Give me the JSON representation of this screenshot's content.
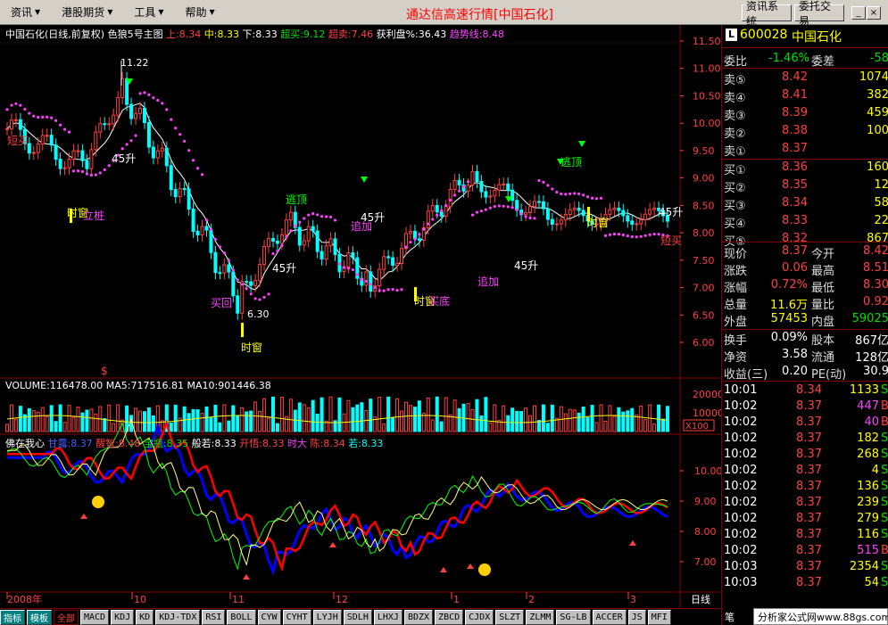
{
  "menubar": {
    "items": [
      {
        "label": "资讯"
      },
      {
        "label": "港股期货"
      },
      {
        "label": "工具"
      },
      {
        "label": "帮助"
      }
    ],
    "title": "通达信高速行情[中国石化]",
    "btn_info": "资讯系统",
    "btn_trade": "委托交易"
  },
  "price_header": {
    "name": "中国石化(日线,前复权)",
    "style": "色狼5号主图",
    "up": "上:8.34",
    "mid": "中:8.33",
    "down": "下:8.33",
    "overbuy": "超买:9.12",
    "oversell": "超卖:7.46",
    "profit": "获利盘%:36.43",
    "trend": "趋势线:8.48"
  },
  "price_axis": [
    "11.50",
    "11.00",
    "10.50",
    "10.00",
    "9.50",
    "9.00",
    "8.50",
    "8.00",
    "7.50",
    "7.00",
    "6.50",
    "6.00"
  ],
  "annotations": {
    "high": "11.22",
    "low": "6.30",
    "short_buy": "短买",
    "time_window": "时窗",
    "rise45": "45升",
    "escape_top": "逃顶",
    "chase": "追加",
    "buy_bottom": "买底",
    "buy_back": "买回",
    "support": "立桩"
  },
  "volume_header": {
    "volume": "VOLUME:116478.00",
    "ma5": "MA5:717516.81",
    "ma10": "MA10:901446.38"
  },
  "volume_axis": [
    "20000",
    "10000"
  ],
  "volume_unit": "X100",
  "indicator_header": {
    "name": "佛在我心",
    "sweet": "甘露:8.37",
    "wake": "醒智:8.48",
    "treasure": "宝瓶:8.35",
    "prajna": "般若:8.33",
    "open": "开悟:8.33",
    "gold": "时大",
    "chen": "陈:8.34",
    "ruo": "若:8.33"
  },
  "indicator_axis": [
    "10.00",
    "9.00",
    "8.00",
    "7.00"
  ],
  "time_axis": [
    "2008年",
    "10",
    "11",
    "12",
    "1",
    "2",
    "3"
  ],
  "period_label": "日线",
  "tabs": [
    "指标",
    "模板",
    "全部",
    "MACD",
    "KDJ",
    "KD",
    "KDJ-TDX",
    "RSI",
    "BOLL",
    "CYW",
    "CYHT",
    "LYJH",
    "SDLH",
    "LHXJ",
    "BDZX",
    "ZBCD",
    "CJDX",
    "SLZT",
    "ZLMM",
    "SG-LB",
    "ACCER",
    "JS",
    "MFI"
  ],
  "quote": {
    "code": "600028",
    "name": "中国石化",
    "weibi_label": "委比",
    "weibi": "-1.46%",
    "weicha_label": "委差",
    "weicha": "-58",
    "asks": [
      {
        "label": "卖⑤",
        "price": "8.42",
        "vol": "1074"
      },
      {
        "label": "卖④",
        "price": "8.41",
        "vol": "382"
      },
      {
        "label": "卖③",
        "price": "8.39",
        "vol": "459"
      },
      {
        "label": "卖②",
        "price": "8.38",
        "vol": "100"
      },
      {
        "label": "卖①",
        "price": "8.37",
        "vol": ""
      }
    ],
    "bids": [
      {
        "label": "买①",
        "price": "8.36",
        "vol": "160"
      },
      {
        "label": "买②",
        "price": "8.35",
        "vol": "12"
      },
      {
        "label": "买③",
        "price": "8.34",
        "vol": "58"
      },
      {
        "label": "买④",
        "price": "8.33",
        "vol": "22"
      },
      {
        "label": "买⑤",
        "price": "8.32",
        "vol": "867"
      }
    ],
    "stats": [
      {
        "l1": "现价",
        "v1": "8.37",
        "l2": "今开",
        "v2": "8.42"
      },
      {
        "l1": "涨跌",
        "v1": "0.06",
        "l2": "最高",
        "v2": "8.51"
      },
      {
        "l1": "涨幅",
        "v1": "0.72%",
        "l2": "最低",
        "v2": "8.30"
      },
      {
        "l1": "总量",
        "v1": "11.6万",
        "l2": "量比",
        "v2": "0.92"
      },
      {
        "l1": "外盘",
        "v1": "57453",
        "l2": "内盘",
        "v2": "59025"
      }
    ],
    "stats2": [
      {
        "l1": "换手",
        "v1": "0.09%",
        "l2": "股本",
        "v2": "867亿"
      },
      {
        "l1": "净资",
        "v1": "3.58",
        "l2": "流通",
        "v2": "128亿"
      },
      {
        "l1": "收益(三)",
        "v1": "0.20",
        "l2": "PE(动)",
        "v2": "30.9"
      }
    ],
    "ticks": [
      {
        "t": "10:01",
        "p": "8.34",
        "v": "1133",
        "f": "S"
      },
      {
        "t": "10:02",
        "p": "8.37",
        "v": "447",
        "f": "B"
      },
      {
        "t": "10:02",
        "p": "8.37",
        "v": "40",
        "f": "B"
      },
      {
        "t": "10:02",
        "p": "8.37",
        "v": "182",
        "f": "S"
      },
      {
        "t": "10:02",
        "p": "8.37",
        "v": "268",
        "f": "S"
      },
      {
        "t": "10:02",
        "p": "8.37",
        "v": "4",
        "f": "S"
      },
      {
        "t": "10:02",
        "p": "8.37",
        "v": "136",
        "f": "S"
      },
      {
        "t": "10:02",
        "p": "8.37",
        "v": "239",
        "f": "S"
      },
      {
        "t": "10:02",
        "p": "8.37",
        "v": "279",
        "f": "S"
      },
      {
        "t": "10:02",
        "p": "8.37",
        "v": "116",
        "f": "S"
      },
      {
        "t": "10:02",
        "p": "8.37",
        "v": "515",
        "f": "B"
      },
      {
        "t": "10:03",
        "p": "8.37",
        "v": "2354",
        "f": "S"
      },
      {
        "t": "10:03",
        "p": "8.37",
        "v": "54",
        "f": "S"
      }
    ]
  },
  "bottom_tag": "分析家公式网www.88gs.com",
  "bottom_small": "笔",
  "colors": {
    "up": "#ff4040",
    "down": "#00ffff",
    "grid": "#800000",
    "dots": "#ff40ff",
    "axis": "#ff4040"
  }
}
